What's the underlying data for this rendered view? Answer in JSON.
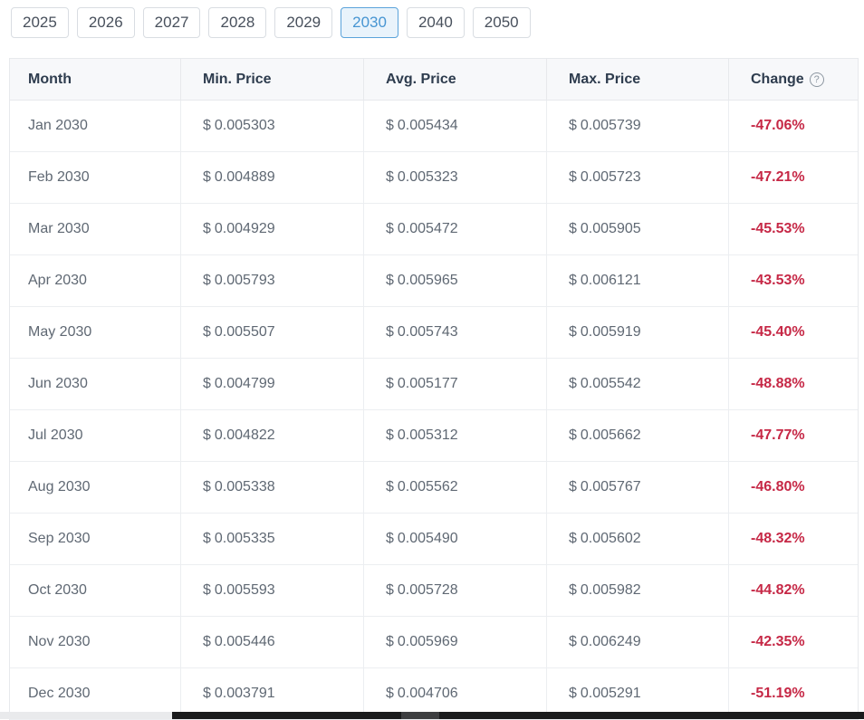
{
  "tabs": [
    {
      "label": "2025",
      "active": false
    },
    {
      "label": "2026",
      "active": false
    },
    {
      "label": "2027",
      "active": false
    },
    {
      "label": "2028",
      "active": false
    },
    {
      "label": "2029",
      "active": false
    },
    {
      "label": "2030",
      "active": true
    },
    {
      "label": "2040",
      "active": false
    },
    {
      "label": "2050",
      "active": false
    }
  ],
  "table": {
    "headers": [
      "Month",
      "Min. Price",
      "Avg. Price",
      "Max. Price",
      "Change"
    ],
    "help_icon": "?",
    "currency": "$",
    "rows": [
      {
        "month": "Jan 2030",
        "min": "0.005303",
        "avg": "0.005434",
        "max": "0.005739",
        "change": "-47.06%"
      },
      {
        "month": "Feb 2030",
        "min": "0.004889",
        "avg": "0.005323",
        "max": "0.005723",
        "change": "-47.21%"
      },
      {
        "month": "Mar 2030",
        "min": "0.004929",
        "avg": "0.005472",
        "max": "0.005905",
        "change": "-45.53%"
      },
      {
        "month": "Apr 2030",
        "min": "0.005793",
        "avg": "0.005965",
        "max": "0.006121",
        "change": "-43.53%"
      },
      {
        "month": "May 2030",
        "min": "0.005507",
        "avg": "0.005743",
        "max": "0.005919",
        "change": "-45.40%"
      },
      {
        "month": "Jun 2030",
        "min": "0.004799",
        "avg": "0.005177",
        "max": "0.005542",
        "change": "-48.88%"
      },
      {
        "month": "Jul 2030",
        "min": "0.004822",
        "avg": "0.005312",
        "max": "0.005662",
        "change": "-47.77%"
      },
      {
        "month": "Aug 2030",
        "min": "0.005338",
        "avg": "0.005562",
        "max": "0.005767",
        "change": "-46.80%"
      },
      {
        "month": "Sep 2030",
        "min": "0.005335",
        "avg": "0.005490",
        "max": "0.005602",
        "change": "-48.32%"
      },
      {
        "month": "Oct 2030",
        "min": "0.005593",
        "avg": "0.005728",
        "max": "0.005982",
        "change": "-44.82%"
      },
      {
        "month": "Nov 2030",
        "min": "0.005446",
        "avg": "0.005969",
        "max": "0.006249",
        "change": "-42.35%"
      },
      {
        "month": "Dec 2030",
        "min": "0.003791",
        "avg": "0.004706",
        "max": "0.005291",
        "change": "-51.19%"
      }
    ]
  },
  "colors": {
    "accent_blue": "#4795d2",
    "active_tab_bg": "#e9f3fb",
    "active_tab_border": "#5ba3da",
    "change_red": "#c62846",
    "header_bg": "#f7f8fa",
    "header_text": "#2e3c4e",
    "cell_text": "#5f6873",
    "border": "#e7e9ec"
  }
}
